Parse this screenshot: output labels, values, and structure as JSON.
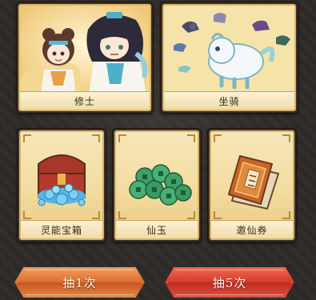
{
  "summon_pool": {
    "large_cards": [
      {
        "label": "修士",
        "icon": "cultivator-characters-art"
      },
      {
        "label": "坐骑",
        "icon": "mount-beasts-art"
      }
    ],
    "small_cards": [
      {
        "label": "灵能宝箱",
        "icon": "treasure-chest-icon"
      },
      {
        "label": "仙玉",
        "icon": "jade-coins-icon"
      },
      {
        "label": "邀仙券",
        "icon": "invitation-ticket-icon"
      }
    ]
  },
  "buttons": {
    "draw_one": "抽1次",
    "draw_five": "抽5次"
  },
  "colors": {
    "card_border": "#d8b36a",
    "button_orange": "#db6e2f",
    "button_red": "#d83a2c"
  }
}
